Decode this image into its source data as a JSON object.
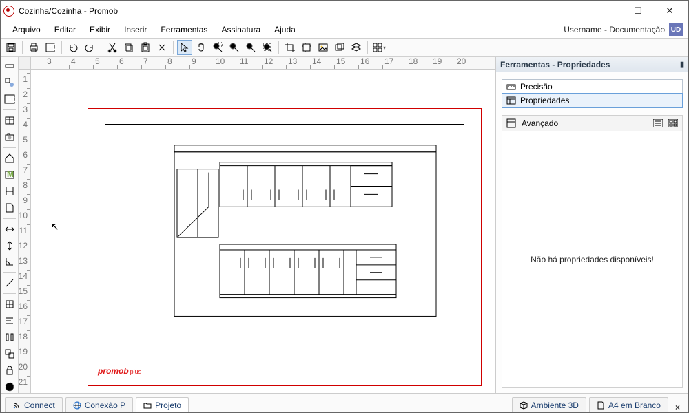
{
  "window": {
    "title": "Cozinha/Cozinha - Promob"
  },
  "menu": {
    "arquivo": "Arquivo",
    "editar": "Editar",
    "exibir": "Exibir",
    "inserir": "Inserir",
    "ferramentas": "Ferramentas",
    "assinatura": "Assinatura",
    "ajuda": "Ajuda"
  },
  "user": {
    "label": "Username - Documentação",
    "badge": "UD"
  },
  "props": {
    "header": "Ferramentas - Propriedades",
    "tab_precisao": "Precisão",
    "tab_propriedades": "Propriedades",
    "panel_avancado": "Avançado",
    "empty": "Não há propriedades disponíveis!"
  },
  "bottomtabs": {
    "connect": "Connect",
    "conexaop": "Conexão P",
    "projeto": "Projeto",
    "ambiente": "Ambiente 3D",
    "a4": "A4 em Branco"
  },
  "logo": {
    "main": "promob",
    "sub": "plus"
  },
  "ruler": {
    "h": [
      "3",
      "4",
      "5",
      "6",
      "7",
      "8",
      "9",
      "10",
      "11",
      "12",
      "13",
      "14",
      "15",
      "16",
      "17",
      "18",
      "19",
      "20"
    ],
    "v": [
      "1",
      "2",
      "3",
      "4",
      "5",
      "6",
      "7",
      "8",
      "9",
      "10",
      "11",
      "12",
      "13",
      "14",
      "15",
      "16",
      "17",
      "18",
      "19",
      "20",
      "21"
    ]
  }
}
